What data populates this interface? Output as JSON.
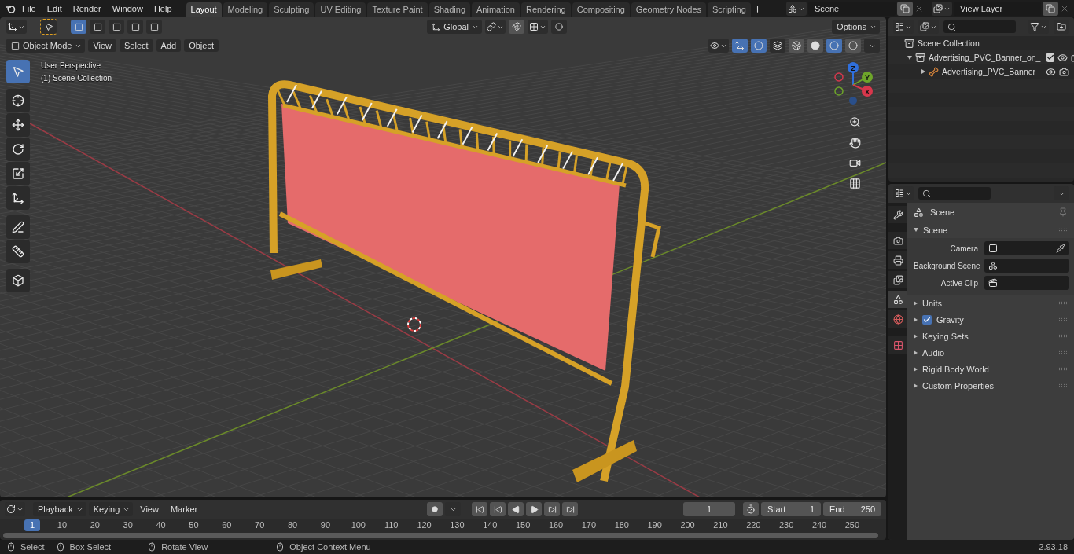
{
  "menu": [
    "File",
    "Edit",
    "Render",
    "Window",
    "Help"
  ],
  "workspaces": [
    {
      "label": "Layout",
      "selected": true
    },
    {
      "label": "Modeling",
      "selected": false
    },
    {
      "label": "Sculpting",
      "selected": false
    },
    {
      "label": "UV Editing",
      "selected": false
    },
    {
      "label": "Texture Paint",
      "selected": false
    },
    {
      "label": "Shading",
      "selected": false
    },
    {
      "label": "Animation",
      "selected": false
    },
    {
      "label": "Rendering",
      "selected": false
    },
    {
      "label": "Compositing",
      "selected": false
    },
    {
      "label": "Geometry Nodes",
      "selected": false
    },
    {
      "label": "Scripting",
      "selected": false
    }
  ],
  "scene_selector": {
    "value": "Scene"
  },
  "view_layer_selector": {
    "value": "View Layer"
  },
  "viewport": {
    "mode": "Object Mode",
    "menus": [
      "View",
      "Select",
      "Add",
      "Object"
    ],
    "orientation": "Global",
    "options": "Options",
    "select_modes": [
      {
        "selected": true
      },
      {
        "selected": false
      },
      {
        "selected": false
      },
      {
        "selected": false
      },
      {
        "selected": false
      }
    ],
    "overlay_text": [
      "User Perspective",
      "(1) Scene Collection"
    ],
    "tools": [
      {
        "kind": "select",
        "selected": true
      },
      {
        "kind": "cursor",
        "selected": false
      },
      {
        "kind": "move",
        "selected": false
      },
      {
        "kind": "rotate",
        "selected": false
      },
      {
        "kind": "scale",
        "selected": false
      },
      {
        "kind": "transform",
        "selected": false
      },
      {
        "kind": "annotate",
        "selected": false
      },
      {
        "kind": "measure",
        "selected": false
      },
      {
        "kind": "add-cube",
        "selected": false
      }
    ],
    "shading": [
      {
        "kind": "wireframe",
        "selected": false
      },
      {
        "kind": "solid",
        "selected": false
      },
      {
        "kind": "material",
        "selected": true
      },
      {
        "kind": "rendered",
        "selected": false
      }
    ],
    "gizmo": [
      {
        "label": "Z",
        "color": "#2f6fdc"
      },
      {
        "label": "Y",
        "color": "#6ea52a"
      },
      {
        "label": "X",
        "color": "#d8374c"
      }
    ]
  },
  "outliner": {
    "root": "Scene Collection",
    "items": [
      {
        "label": "Advertising_PVC_Banner_on_",
        "kind": "collection",
        "expanded": true,
        "checked": true,
        "children": [
          {
            "label": "Advertising_PVC_Banner",
            "kind": "object",
            "expanded": false
          }
        ]
      }
    ]
  },
  "properties": {
    "tabs": [
      {
        "kind": "tool",
        "selected": false
      },
      {
        "kind": "render",
        "selected": false
      },
      {
        "kind": "output",
        "selected": false
      },
      {
        "kind": "view-layer",
        "selected": false
      },
      {
        "kind": "scene",
        "selected": true
      },
      {
        "kind": "world",
        "selected": false
      },
      {
        "kind": "texture",
        "selected": false
      }
    ],
    "context": "Scene",
    "panel": {
      "title": "Scene",
      "expanded": true,
      "fields": [
        {
          "label": "Camera",
          "kind": "camera"
        },
        {
          "label": "Background Scene",
          "kind": "scene"
        },
        {
          "label": "Active Clip",
          "kind": "clip"
        }
      ]
    },
    "subpanels": [
      {
        "label": "Units",
        "expanded": false
      },
      {
        "label": "Gravity",
        "expanded": false,
        "checked": true
      },
      {
        "label": "Keying Sets",
        "expanded": false
      },
      {
        "label": "Audio",
        "expanded": false
      },
      {
        "label": "Rigid Body World",
        "expanded": false
      },
      {
        "label": "Custom Properties",
        "expanded": false
      }
    ]
  },
  "timeline": {
    "menus": [
      {
        "label": "Playback",
        "dropdown": true
      },
      {
        "label": "Keying",
        "dropdown": true
      },
      {
        "label": "View",
        "dropdown": false
      },
      {
        "label": "Marker",
        "dropdown": false
      }
    ],
    "current_frame": "1",
    "start": {
      "label": "Start",
      "value": "1"
    },
    "end": {
      "label": "End",
      "value": "250"
    },
    "frame_marker": "1",
    "ticks": [
      "10",
      "20",
      "30",
      "40",
      "50",
      "60",
      "70",
      "80",
      "90",
      "100",
      "110",
      "120",
      "130",
      "140",
      "150",
      "160",
      "170",
      "180",
      "190",
      "200",
      "210",
      "220",
      "230",
      "240",
      "250"
    ]
  },
  "status_bar": {
    "items": [
      {
        "label": "Select",
        "kind": "left"
      },
      {
        "label": "Box Select",
        "kind": "drag"
      },
      {
        "label": "Rotate View",
        "kind": "middle"
      },
      {
        "label": "Object Context Menu",
        "kind": "right"
      }
    ],
    "version": "2.93.18"
  }
}
